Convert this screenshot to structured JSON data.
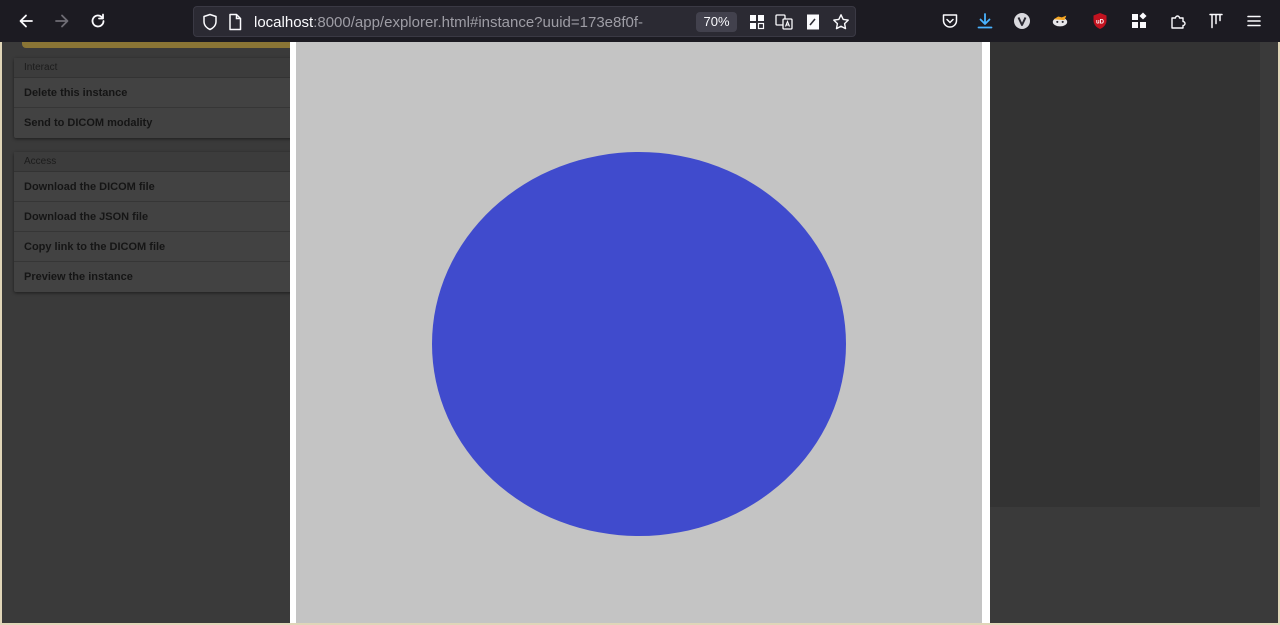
{
  "browser": {
    "url_host": "localhost",
    "url_rest": ":8000/app/explorer.html#instance?uuid=173e8f0f-",
    "zoom": "70%",
    "icons": [
      "back-icon",
      "forward-icon",
      "reload-icon",
      "shield-icon",
      "page-icon",
      "extension-grid-icon",
      "translate-icon",
      "reader-icon",
      "bookmark-star-icon",
      "pocket-icon",
      "download-icon",
      "vimium-icon",
      "fox-extension-icon",
      "ublock-icon",
      "extensions-icon",
      "puzzle-icon",
      "tree-icon",
      "hamburger-menu-icon"
    ]
  },
  "sidebar": {
    "interact": {
      "title": "Interact",
      "items": [
        "Delete this instance",
        "Send to DICOM modality"
      ]
    },
    "access": {
      "title": "Access",
      "items": [
        "Download the DICOM file",
        "Download the JSON file",
        "Copy link to the DICOM file",
        "Preview the instance"
      ]
    }
  },
  "preview": {
    "background_color": "#c4c4c4",
    "shape_color": "#404bcd"
  }
}
